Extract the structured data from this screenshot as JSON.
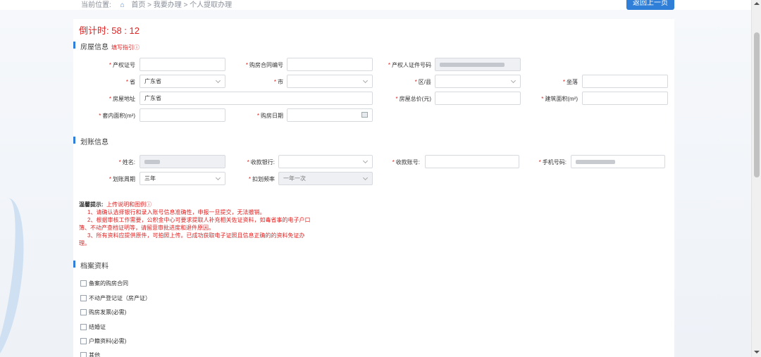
{
  "breadcrumb": {
    "prefix": "当前位置:",
    "path": "首页 > 我要办理 > 个人提取办理"
  },
  "back_label": "返回上一页",
  "countdown": "倒计时: 58 : 12",
  "house": {
    "title": "房屋信息",
    "guide": "填写指引ⓘ",
    "labels": {
      "cert_no": "产权证号",
      "contract_no": "购房合同编号",
      "owner_id": "产权人证件号码",
      "province": "省",
      "city": "市",
      "district": "区/县",
      "seat": "坐落",
      "address": "房屋地址",
      "total_price": "房屋总价(元)",
      "build_area": "建筑面积(m²)",
      "inner_area": "套内面积(m²)",
      "buy_date": "购房日期"
    },
    "values": {
      "province": "广东省",
      "address": "广东省"
    }
  },
  "transfer": {
    "title": "划账信息",
    "labels": {
      "name": "姓名:",
      "bank": "收款银行:",
      "account": "收款账号:",
      "phone": "手机号码:",
      "period": "划账周期",
      "freq": "扣划频率"
    },
    "values": {
      "period": "三年",
      "freq": "一年一次"
    }
  },
  "tips": {
    "title": "温馨提示:",
    "link": "上传说明和图例ⓘ",
    "lines": [
      "1、请确认选择银行和录入账号信息准确性，申报一旦提交，无法撤销。",
      "2、根据审核工作需要，公积金中心可要求提取人补充相关佐证资料，如毒省事的电子户口簿、不动产查档证明等，请留意审批进度和退件原因。",
      "3、所有资料应提供原件，可拍照上传。已成功获取电子证照且信息正确的的资料免证办理。"
    ]
  },
  "archive": {
    "title": "档案资料",
    "items": [
      "备案的购房合同",
      "不动产登记证（房产证）",
      "购房发票(必需)",
      "结婚证",
      "户籍资料(必需)",
      "其他"
    ]
  },
  "colors": {
    "accent": "#2f7fd8",
    "danger": "#e02424"
  }
}
